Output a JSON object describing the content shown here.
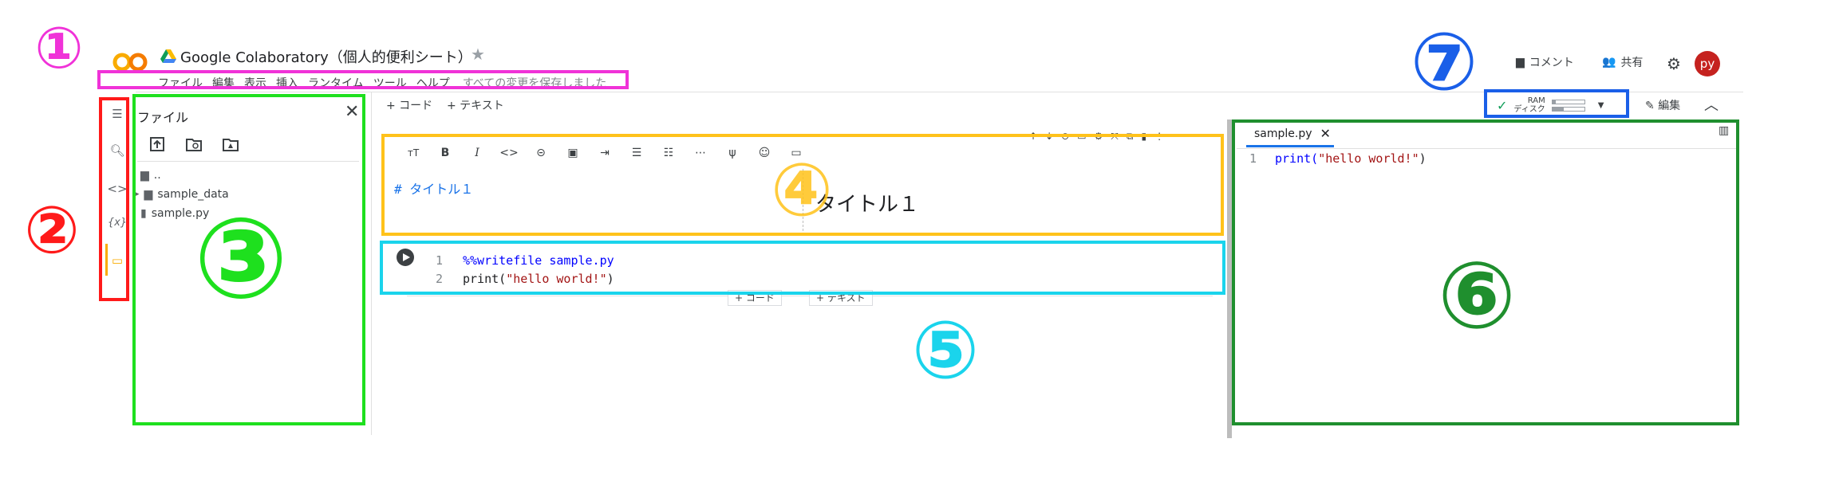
{
  "header": {
    "title": "Google Colaboratory（個人的便利シート）",
    "menu": [
      "ファイル",
      "編集",
      "表示",
      "挿入",
      "ランタイム",
      "ツール",
      "ヘルプ"
    ],
    "save_status": "すべての変更を保存しました",
    "comment_label": "コメント",
    "share_label": "共有",
    "avatar_text": "py"
  },
  "toolbar": {
    "add_code": "+ コード",
    "add_text": "+ テキスト",
    "ram_label": "RAM",
    "disk_label": "ディスク",
    "ram_usage": 0.1,
    "disk_usage": 0.35,
    "edit_label": "編集"
  },
  "file_panel": {
    "title": "ファイル",
    "items": [
      "..",
      "sample_data",
      "sample.py"
    ]
  },
  "markdown_cell": {
    "source": "# タイトル１",
    "rendered": "タイトル１"
  },
  "code_cell": {
    "line_numbers": [
      "1",
      "2"
    ],
    "line1": "%%writefile sample.py",
    "line2_fn": "print(",
    "line2_str": "\"hello world!\"",
    "line2_end": ")",
    "add_code": "+ コード",
    "add_text": "+ テキスト"
  },
  "editor": {
    "tab_name": "sample.py",
    "line_number": "1",
    "code_fn": "print(",
    "code_str": "\"hello world!\"",
    "code_end": ")"
  },
  "annotations": [
    {
      "label": "①",
      "color": "#f032d8"
    },
    {
      "label": "②",
      "color": "#ff1a1a"
    },
    {
      "label": "③",
      "color": "#1ee01e"
    },
    {
      "label": "④",
      "color": "#ffc21a"
    },
    {
      "label": "⑤",
      "color": "#1ad4ec"
    },
    {
      "label": "⑥",
      "color": "#1f8f2e"
    },
    {
      "label": "⑦",
      "color": "#1a5fe8"
    }
  ]
}
